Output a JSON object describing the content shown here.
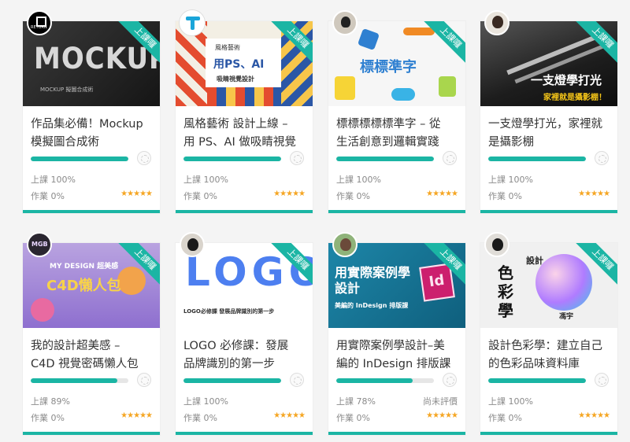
{
  "labels": {
    "ribbon": "上課囉",
    "class_prefix": "上課",
    "homework_prefix": "作業",
    "stars": "★★★★★"
  },
  "courses": [
    {
      "line1": "作品集必備！Mockup",
      "line2": "模擬圖合成術",
      "class": "100%",
      "homework": "0%",
      "progress": 100,
      "thumb_text": "MOCKUP",
      "thumb_sub": "MOCKUP 擬圖合成術",
      "avatar_text": "RETURN"
    },
    {
      "line1": "風格藝術 設計上線 –",
      "line2": "用 PS、AI 做吸睛視覺",
      "class": "100%",
      "homework": "0%",
      "progress": 100,
      "thumb_text": "用PS、AI",
      "thumb_sub": "吸睛視覺設計",
      "thumb_top": "風格藝術"
    },
    {
      "line1": "標標標標標準字 – 從",
      "line2": "生活創意到邏輯實踐",
      "class": "100%",
      "homework": "0%",
      "progress": 100,
      "thumb_text": "標標準字"
    },
    {
      "line1": "一支燈學打光，家裡就",
      "line2": "是攝影棚",
      "class": "100%",
      "homework": "0%",
      "progress": 100,
      "thumb_text": "一支燈學打光",
      "thumb_sub": "家裡就是攝影棚！"
    },
    {
      "line1": "我的設計超美感 –",
      "line2": "C4D 視覺密碼懶人包",
      "class": "89%",
      "homework": "0%",
      "progress": 89,
      "thumb_text": "C4D懶人包",
      "thumb_top": "MY DESIGN 超美感",
      "avatar_text": "MGB"
    },
    {
      "line1": "LOGO 必修課：發展",
      "line2": "品牌識別的第一步",
      "class": "100%",
      "homework": "0%",
      "progress": 100,
      "thumb_text": "LOGO",
      "thumb_sub": "LOGO必修課 發展品牌識別的第一步"
    },
    {
      "line1": "用實際案例學設計–美",
      "line2": "編的 InDesign 排版課",
      "class": "78%",
      "homework": "0%",
      "progress": 78,
      "thumb_text": "用實際案例學設計",
      "thumb_sub": "美編的 InDesign 排版課",
      "thumb_logo": "Id",
      "rating": "尚未評價"
    },
    {
      "line1": "設計色彩學：建立自己",
      "line2": "的色彩品味資料庫",
      "class": "100%",
      "homework": "0%",
      "progress": 100,
      "thumb_text": "色彩學",
      "thumb_top": "設計",
      "thumb_sub": "馮宇"
    }
  ],
  "colors": {
    "accent": "#1bb5a4",
    "star": "#f5a623",
    "id_brand": "#cc1f6e"
  }
}
